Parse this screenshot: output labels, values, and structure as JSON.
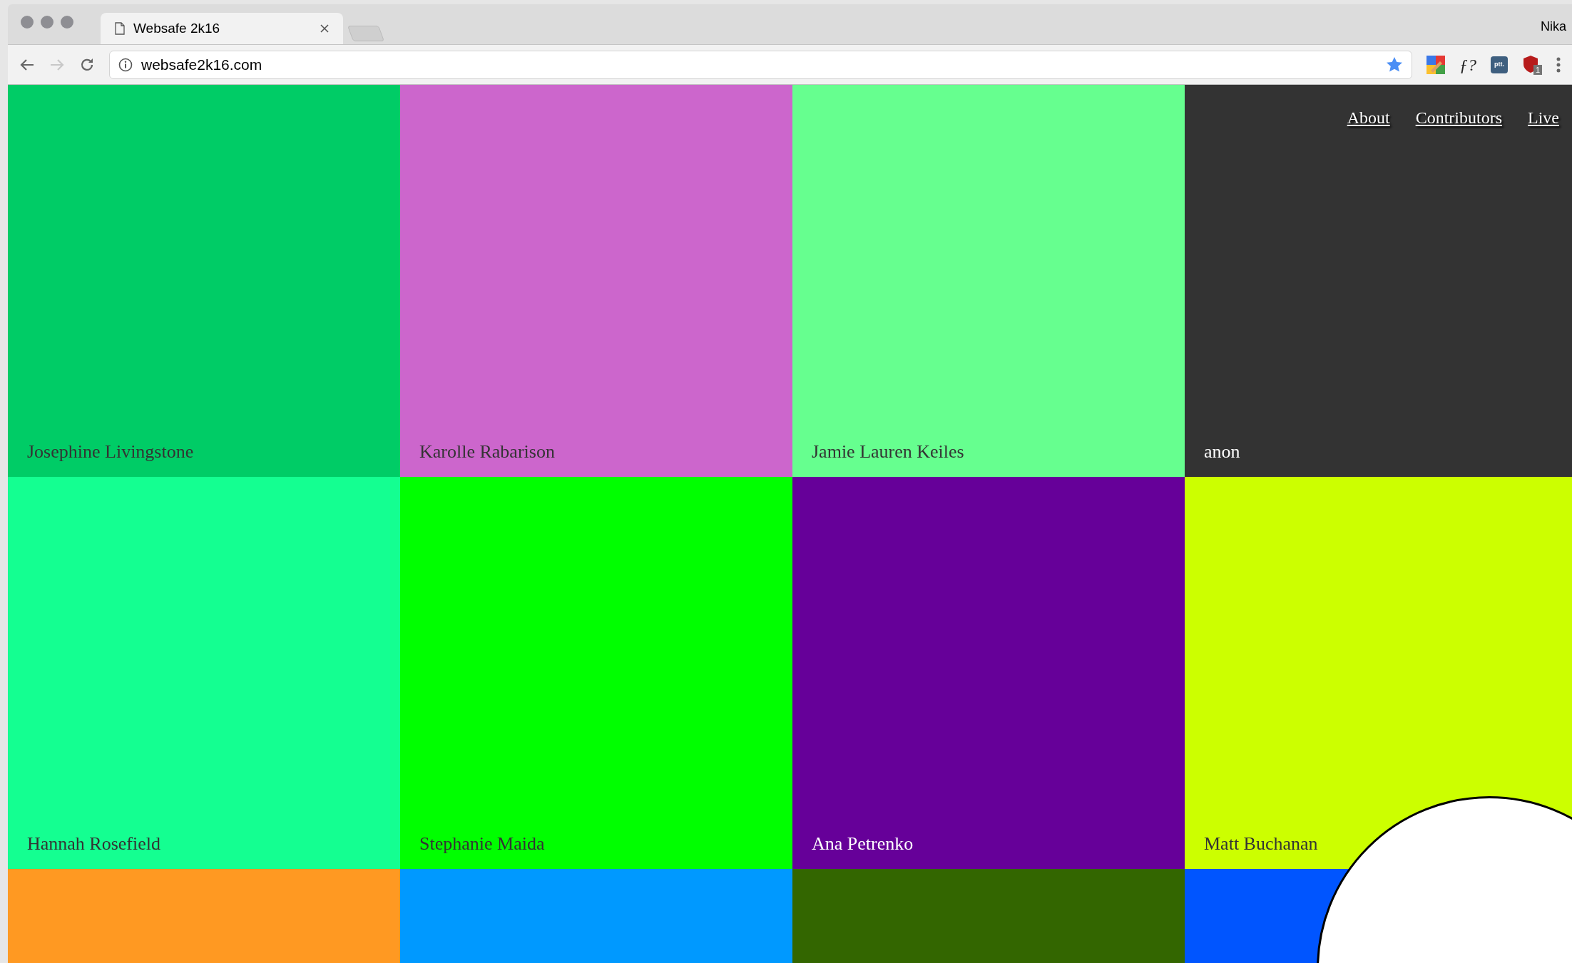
{
  "browser": {
    "tab_title": "Websafe 2k16",
    "profile": "Nika",
    "address": "websafe2k16.com",
    "font_extension": "ƒ?",
    "ptt_extension": "ptt.",
    "extension_badge": "1"
  },
  "nav": [
    "About",
    "Contributors",
    "Live"
  ],
  "tiles": [
    {
      "name": "Josephine Livingstone",
      "color": "#00cc66"
    },
    {
      "name": "Karolle Rabarison",
      "color": "#cc66cc"
    },
    {
      "name": "Jamie Lauren Keiles",
      "color": "#66ff8f"
    },
    {
      "name": "anon",
      "color": "#333333"
    },
    {
      "name": "Hannah Rosefield",
      "color": "#14ff91"
    },
    {
      "name": "Stephanie Maida",
      "color": "#00ff00"
    },
    {
      "name": "Ana Petrenko",
      "color": "#660099"
    },
    {
      "name": "Matt Buchanan",
      "color": "#ccff00"
    },
    {
      "color": "#ff9922"
    },
    {
      "color": "#0099ff"
    },
    {
      "color": "#336600"
    },
    {
      "color": "#0055ff"
    }
  ]
}
